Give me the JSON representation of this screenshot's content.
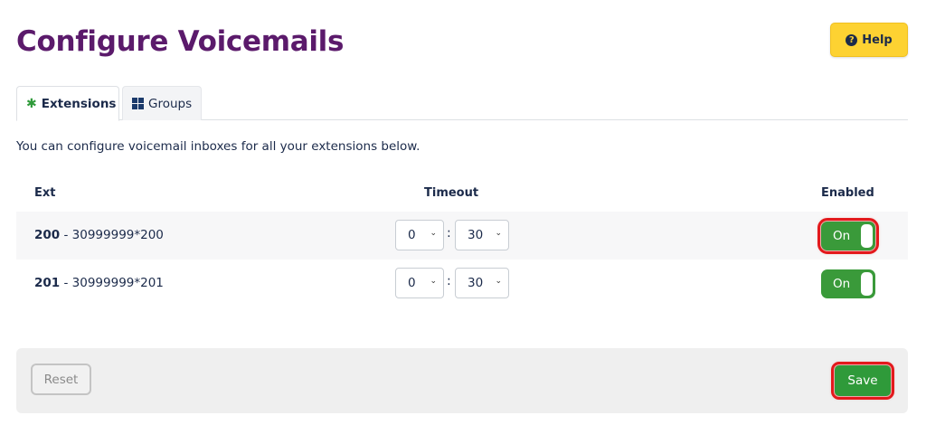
{
  "header": {
    "title": "Configure Voicemails",
    "help_label": "Help",
    "help_icon": "question-circle-icon"
  },
  "tabs": [
    {
      "label": "Extensions",
      "icon": "asterisk-icon",
      "active": true
    },
    {
      "label": "Groups",
      "icon": "grid-icon",
      "active": false
    }
  ],
  "intro": "You can configure voicemail inboxes for all your extensions below.",
  "table": {
    "headers": {
      "ext": "Ext",
      "timeout": "Timeout",
      "enabled": "Enabled"
    },
    "separator": " - ",
    "colon": ":",
    "rows": [
      {
        "ext": "200",
        "number": "30999999*200",
        "hours": "0",
        "minutes": "30",
        "enabled_label": "On"
      },
      {
        "ext": "201",
        "number": "30999999*201",
        "hours": "0",
        "minutes": "30",
        "enabled_label": "On"
      }
    ]
  },
  "footer": {
    "reset_label": "Reset",
    "save_label": "Save"
  },
  "colors": {
    "title": "#5b1a6b",
    "accent_green": "#2f9a3a",
    "help_yellow": "#fdd232",
    "highlight_red": "#e3191c"
  }
}
